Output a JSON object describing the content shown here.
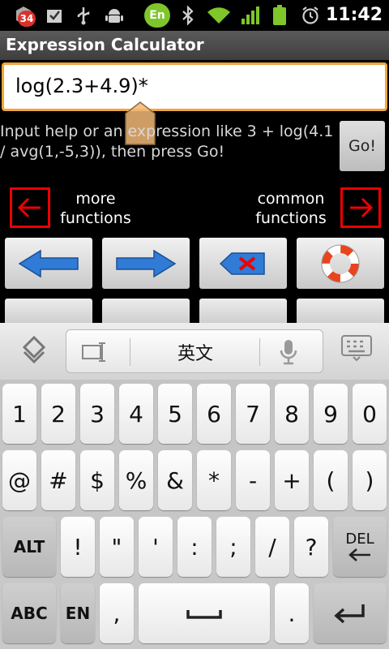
{
  "status_bar": {
    "notification_count": "34",
    "ime_badge": "En",
    "time": "11:42",
    "icons": [
      "notification-icon",
      "checkbox-icon",
      "usb-icon",
      "android-debug-icon",
      "ime-icon",
      "bluetooth-icon",
      "wifi-icon",
      "signal-icon",
      "battery-icon",
      "alarm-icon"
    ]
  },
  "app": {
    "title": "Expression Calculator"
  },
  "expression": {
    "value": "log(2.3+4.9)*"
  },
  "help": {
    "text": "Input help or an expression like 3 + log(4.1 / avg(1,-5,3)), then press Go!",
    "go_label": "Go!"
  },
  "function_nav": {
    "more_label_1": "more",
    "more_label_2": "functions",
    "common_label_1": "common",
    "common_label_2": "functions",
    "accent_color": "#e00000"
  },
  "calc_buttons": [
    {
      "icon": "arrow-left-icon"
    },
    {
      "icon": "arrow-right-icon"
    },
    {
      "icon": "backspace-icon"
    },
    {
      "icon": "lifebuoy-icon"
    }
  ],
  "keyboard": {
    "candidate_text": "英文",
    "row1": [
      "1",
      "2",
      "3",
      "4",
      "5",
      "6",
      "7",
      "8",
      "9",
      "0"
    ],
    "row2": [
      "@",
      "#",
      "$",
      "%",
      "&",
      "*",
      "-",
      "+",
      "(",
      ")"
    ],
    "row3": {
      "alt": "ALT",
      "keys": [
        "!",
        "\"",
        "'",
        ":",
        ";",
        "/",
        "?"
      ],
      "del": "DEL"
    },
    "row4": {
      "abc": "ABC",
      "en": "EN",
      "comma": ",",
      "period": "."
    }
  }
}
